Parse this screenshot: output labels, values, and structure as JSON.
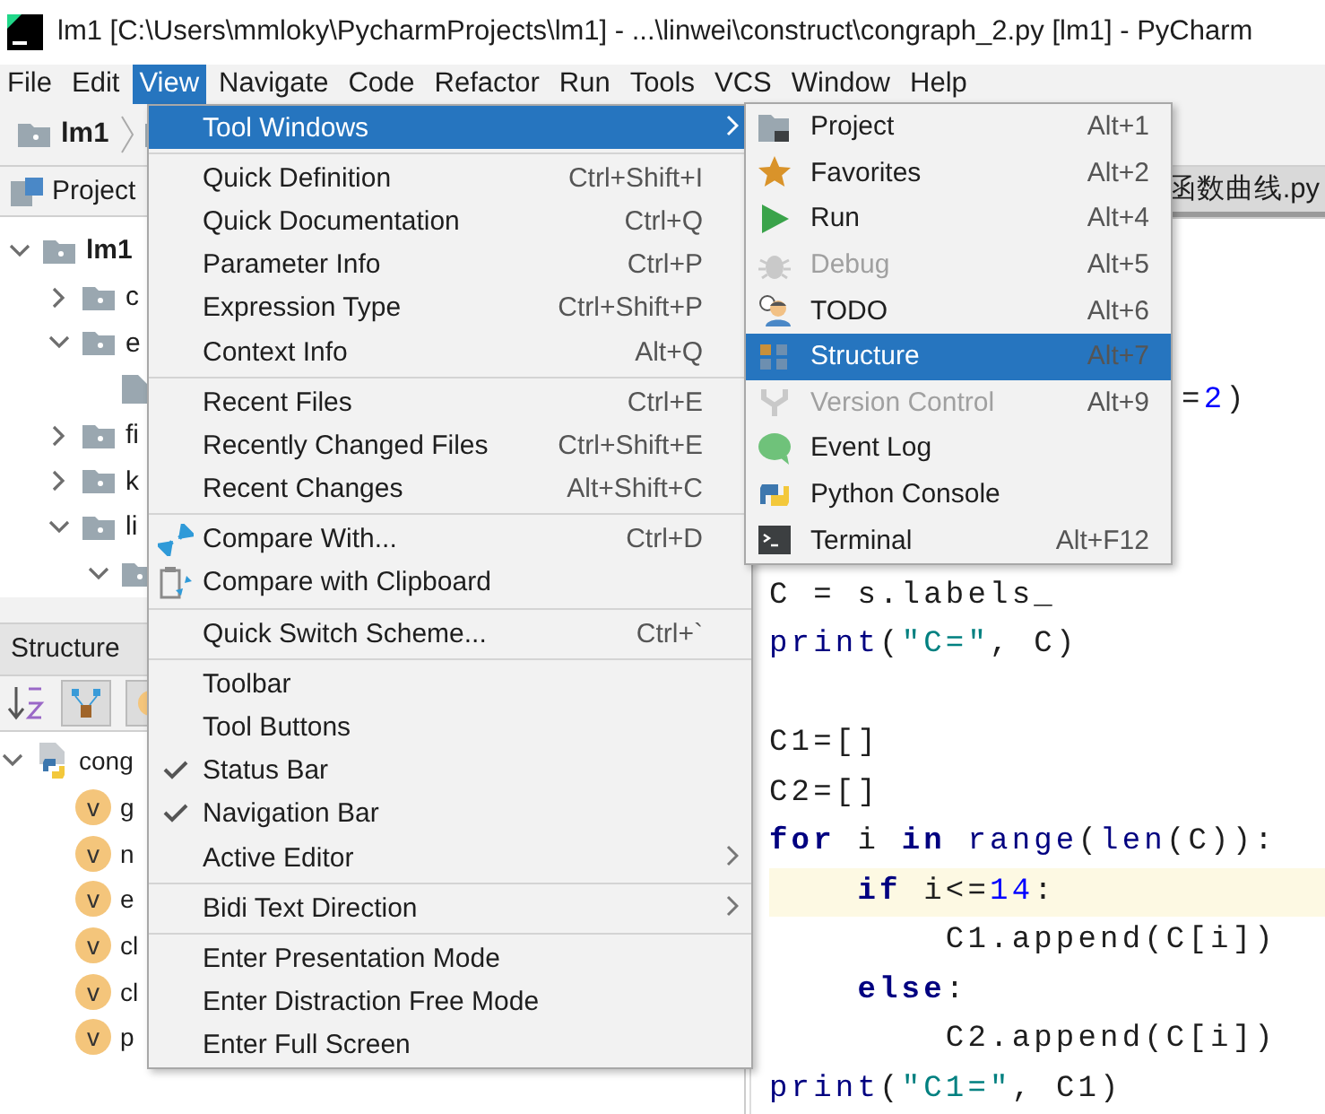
{
  "window": {
    "title": "lm1 [C:\\Users\\mmloky\\PycharmProjects\\lm1] - ...\\linwei\\construct\\congraph_2.py [lm1] - PyCharm"
  },
  "menubar": [
    {
      "label": "File",
      "selected": false
    },
    {
      "label": "Edit",
      "selected": false
    },
    {
      "label": "View",
      "selected": true
    },
    {
      "label": "Navigate",
      "selected": false
    },
    {
      "label": "Code",
      "selected": false
    },
    {
      "label": "Refactor",
      "selected": false
    },
    {
      "label": "Run",
      "selected": false
    },
    {
      "label": "Tools",
      "selected": false
    },
    {
      "label": "VCS",
      "selected": false
    },
    {
      "label": "Window",
      "selected": false
    },
    {
      "label": "Help",
      "selected": false
    }
  ],
  "navbar": {
    "items": [
      "lm1"
    ]
  },
  "project_panel": {
    "title": "Project",
    "tree": [
      {
        "label": "lm1",
        "expanded": true,
        "children": [
          {
            "label": "c",
            "expanded": false
          },
          {
            "label": "e",
            "expanded": true,
            "children": [
              {
                "kind": "file"
              }
            ]
          },
          {
            "label": "fi",
            "expanded": false
          },
          {
            "label": "k",
            "expanded": false
          },
          {
            "label": "li",
            "expanded": true,
            "children": [
              {
                "kind": "folder",
                "expanded": true
              }
            ]
          }
        ]
      }
    ]
  },
  "structure_panel": {
    "title": "Structure",
    "tree": [
      {
        "label": "cong",
        "expanded": true,
        "children": [
          {
            "label": "g",
            "badge": "v"
          },
          {
            "label": "n",
            "badge": "v"
          },
          {
            "label": "e",
            "badge": "v"
          },
          {
            "label": "cl",
            "badge": "v"
          },
          {
            "label": "cl",
            "badge": "v"
          },
          {
            "label": "p",
            "badge": "v"
          }
        ]
      }
    ]
  },
  "editor": {
    "tab": "函数曲线.py",
    "lines": [
      {
        "current": false,
        "tokens": [
          {
            "text": "=",
            "kind": "plain"
          },
          {
            "text": "2",
            "kind": "number"
          },
          {
            "text": ")",
            "kind": "plain"
          }
        ]
      },
      {
        "current": false,
        "tokens": [
          {
            "text": "C = s.labels_",
            "kind": "plain"
          }
        ]
      },
      {
        "current": false,
        "tokens": [
          {
            "text": "print",
            "kind": "builtin"
          },
          {
            "text": "(",
            "kind": "plain"
          },
          {
            "text": "\"C=\"",
            "kind": "string"
          },
          {
            "text": ", C)",
            "kind": "plain"
          }
        ]
      },
      {
        "current": false,
        "tokens": [
          {
            "text": "C1=[]",
            "kind": "plain"
          }
        ]
      },
      {
        "current": false,
        "tokens": [
          {
            "text": "C2=[]",
            "kind": "plain"
          }
        ]
      },
      {
        "current": false,
        "tokens": [
          {
            "text": "for",
            "kind": "keyword"
          },
          {
            "text": " i ",
            "kind": "plain"
          },
          {
            "text": "in",
            "kind": "keyword"
          },
          {
            "text": " range",
            "kind": "builtin"
          },
          {
            "text": "(",
            "kind": "plain"
          },
          {
            "text": "len",
            "kind": "builtin"
          },
          {
            "text": "(C)):",
            "kind": "plain"
          }
        ]
      },
      {
        "current": true,
        "tokens": [
          {
            "text": "    if",
            "kind": "keyword"
          },
          {
            "text": " i<=",
            "kind": "plain"
          },
          {
            "text": "14",
            "kind": "number"
          },
          {
            "text": ":",
            "kind": "plain"
          }
        ]
      },
      {
        "current": false,
        "tokens": [
          {
            "text": "        C1.append(C[i])",
            "kind": "plain"
          }
        ]
      },
      {
        "current": false,
        "tokens": [
          {
            "text": "    else",
            "kind": "keyword"
          },
          {
            "text": ":",
            "kind": "plain"
          }
        ]
      },
      {
        "current": false,
        "tokens": [
          {
            "text": "        C2.append(C[i])",
            "kind": "plain"
          }
        ]
      },
      {
        "current": false,
        "tokens": [
          {
            "text": "print",
            "kind": "builtin"
          },
          {
            "text": "(",
            "kind": "plain"
          },
          {
            "text": "\"C1=\"",
            "kind": "string"
          },
          {
            "text": ", C1)",
            "kind": "plain"
          }
        ]
      }
    ]
  },
  "view_menu": [
    {
      "kind": "item",
      "label": "Tool Windows",
      "selected": true,
      "checked": false,
      "submenu": true
    },
    {
      "kind": "separator"
    },
    {
      "kind": "item",
      "label": "Quick Definition",
      "shortcut": "Ctrl+Shift+I",
      "selected": false,
      "checked": false,
      "submenu": false
    },
    {
      "kind": "item",
      "label": "Quick Documentation",
      "shortcut": "Ctrl+Q",
      "selected": false,
      "checked": false,
      "submenu": false
    },
    {
      "kind": "item",
      "label": "Parameter Info",
      "shortcut": "Ctrl+P",
      "selected": false,
      "checked": false,
      "submenu": false
    },
    {
      "kind": "item",
      "label": "Expression Type",
      "shortcut": "Ctrl+Shift+P",
      "selected": false,
      "checked": false,
      "submenu": false
    },
    {
      "kind": "item",
      "label": "Context Info",
      "shortcut": "Alt+Q",
      "selected": false,
      "checked": false,
      "submenu": false
    },
    {
      "kind": "separator"
    },
    {
      "kind": "item",
      "label": "Recent Files",
      "shortcut": "Ctrl+E",
      "selected": false,
      "checked": false,
      "submenu": false
    },
    {
      "kind": "item",
      "label": "Recently Changed Files",
      "shortcut": "Ctrl+Shift+E",
      "selected": false,
      "checked": false,
      "submenu": false
    },
    {
      "kind": "item",
      "label": "Recent Changes",
      "shortcut": "Alt+Shift+C",
      "selected": false,
      "checked": false,
      "submenu": false
    },
    {
      "kind": "separator"
    },
    {
      "kind": "item",
      "label": "Compare With...",
      "shortcut": "Ctrl+D",
      "selected": false,
      "checked": false,
      "submenu": false
    },
    {
      "kind": "item",
      "label": "Compare with Clipboard",
      "selected": false,
      "checked": false,
      "submenu": false
    },
    {
      "kind": "separator"
    },
    {
      "kind": "item",
      "label": "Quick Switch Scheme...",
      "shortcut": "Ctrl+`",
      "selected": false,
      "checked": false,
      "submenu": false
    },
    {
      "kind": "separator"
    },
    {
      "kind": "item",
      "label": "Toolbar",
      "selected": false,
      "checked": false,
      "submenu": false
    },
    {
      "kind": "item",
      "label": "Tool Buttons",
      "selected": false,
      "checked": false,
      "submenu": false
    },
    {
      "kind": "item",
      "label": "Status Bar",
      "selected": false,
      "checked": true,
      "submenu": false
    },
    {
      "kind": "item",
      "label": "Navigation Bar",
      "selected": false,
      "checked": true,
      "submenu": false
    },
    {
      "kind": "item",
      "label": "Active Editor",
      "selected": false,
      "checked": false,
      "submenu": true
    },
    {
      "kind": "separator"
    },
    {
      "kind": "item",
      "label": "Bidi Text Direction",
      "selected": false,
      "checked": false,
      "submenu": true
    },
    {
      "kind": "separator"
    },
    {
      "kind": "item",
      "label": "Enter Presentation Mode",
      "selected": false,
      "checked": false,
      "submenu": false
    },
    {
      "kind": "item",
      "label": "Enter Distraction Free Mode",
      "selected": false,
      "checked": false,
      "submenu": false
    },
    {
      "kind": "item",
      "label": "Enter Full Screen",
      "selected": false,
      "checked": false,
      "submenu": false
    }
  ],
  "tool_windows_menu": [
    {
      "label": "Project",
      "shortcut": "Alt+1",
      "selected": false,
      "disabled": false
    },
    {
      "label": "Favorites",
      "shortcut": "Alt+2",
      "selected": false,
      "disabled": false
    },
    {
      "label": "Run",
      "shortcut": "Alt+4",
      "selected": false,
      "disabled": false
    },
    {
      "label": "Debug",
      "shortcut": "Alt+5",
      "selected": false,
      "disabled": true
    },
    {
      "label": "TODO",
      "shortcut": "Alt+6",
      "selected": false,
      "disabled": false
    },
    {
      "label": "Structure",
      "shortcut": "Alt+7",
      "selected": true,
      "disabled": false
    },
    {
      "label": "Version Control",
      "shortcut": "Alt+9",
      "selected": false,
      "disabled": true
    },
    {
      "label": "Event Log",
      "selected": false,
      "disabled": false
    },
    {
      "label": "Python Console",
      "selected": false,
      "disabled": false
    },
    {
      "label": "Terminal",
      "shortcut": "Alt+F12",
      "selected": false,
      "disabled": false
    }
  ]
}
